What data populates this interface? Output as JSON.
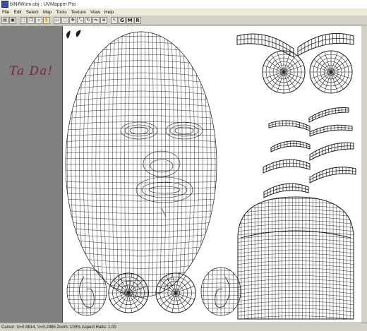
{
  "window": {
    "title": "blNifWom.obj : UVMapper Pro"
  },
  "menu": [
    "File",
    "Edit",
    "Select",
    "Map",
    "Tools",
    "Texture",
    "View",
    "Help"
  ],
  "toolbar": {
    "tools": [
      {
        "name": "open-button",
        "icon": "folder-open-icon",
        "glyph": "▤"
      },
      {
        "name": "save-button",
        "icon": "save-icon",
        "glyph": "▣"
      },
      {
        "name": "sep"
      },
      {
        "name": "select-tool-button",
        "icon": "select-icon",
        "glyph": "⬚"
      },
      {
        "name": "copy-tool-button",
        "icon": "copy-icon",
        "glyph": "❐"
      },
      {
        "name": "zoom-tool-button",
        "icon": "zoom-icon",
        "glyph": "⌕"
      },
      {
        "name": "pan-tool-button",
        "icon": "hand-icon",
        "glyph": "✋"
      },
      {
        "name": "sep"
      },
      {
        "name": "marquee-tool-button",
        "icon": "marquee-icon",
        "glyph": "▭"
      },
      {
        "name": "lasso-tool-button",
        "icon": "lasso-icon",
        "glyph": "◌"
      },
      {
        "name": "move-tool-button",
        "icon": "move-icon",
        "glyph": "✥"
      },
      {
        "name": "scale-tool-button",
        "icon": "scale-icon",
        "glyph": "⤡"
      },
      {
        "name": "rotate-tool-button",
        "icon": "rotate-icon",
        "glyph": "↻"
      },
      {
        "name": "flip-tool-button",
        "icon": "flip-icon",
        "glyph": "⇋"
      },
      {
        "name": "weld-tool-button",
        "icon": "weld-icon",
        "glyph": "⊕"
      },
      {
        "name": "sep"
      },
      {
        "name": "vertex-mode-button",
        "icon": "vertex-icon",
        "glyph": "↖"
      },
      {
        "name": "group-mode-button",
        "icon": "",
        "glyph": "G"
      },
      {
        "name": "material-mode-button",
        "icon": "",
        "glyph": "M"
      },
      {
        "name": "region-mode-button",
        "icon": "",
        "glyph": "R"
      }
    ]
  },
  "annotation": {
    "text": "Ta Da!"
  },
  "status": {
    "text": "Cursor: U=0.9614, V=0.2986  Zoom: 100%  Aspect Ratio: 1.00"
  },
  "colors": {
    "annotation": "#7a1f47",
    "wire": "#1a1a1a",
    "panel": "#808080"
  }
}
